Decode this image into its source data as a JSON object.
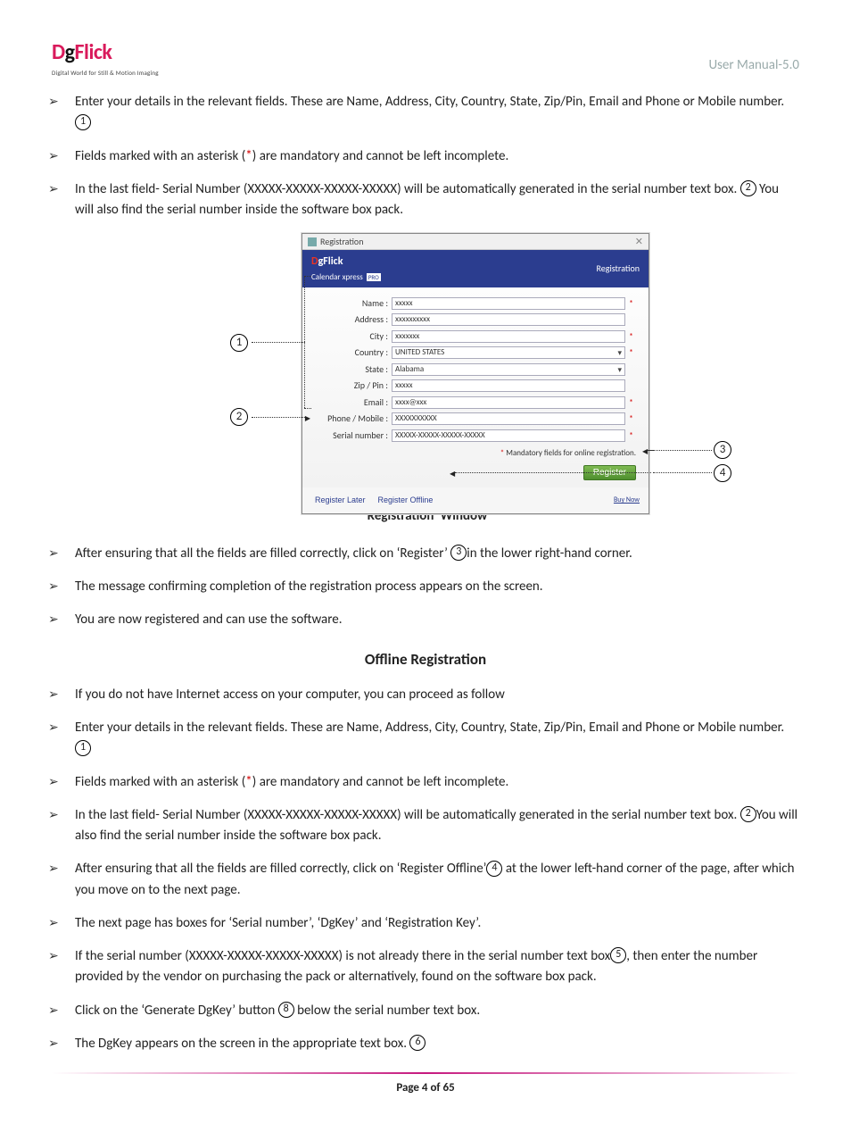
{
  "header": {
    "logo_main": "DgFlick",
    "logo_sub": "Digital World for Still & Motion Imaging",
    "right": "User Manual-5.0"
  },
  "section1": {
    "items": [
      {
        "pre": "Enter your details in the relevant fields. These are Name, Address, City, Country, State, Zip/Pin, Email and Phone or Mobile number. ",
        "circ": "1",
        "post": ""
      },
      {
        "pre": "Fields marked with an asterisk (",
        "red": "*",
        "post2": ") are mandatory and cannot be left incomplete."
      },
      {
        "pre": "In the last field- Serial Number (XXXXX-XXXXX-XXXXX-XXXXX) will be automatically generated in the serial number text box. ",
        "circ": "2",
        "post": " You will also find the serial number inside the software box pack."
      }
    ]
  },
  "figure": {
    "titlebar": "Registration",
    "banner_brand": "DgFlick",
    "banner_sub": "Calendar xpress",
    "banner_pro": "PRO",
    "banner_right": "Registration",
    "rows": [
      {
        "label": "Name :",
        "value": "xxxxx",
        "star": true
      },
      {
        "label": "Address :",
        "value": "xxxxxxxxxx",
        "star": false
      },
      {
        "label": "City :",
        "value": "xxxxxxx",
        "star": true
      },
      {
        "label": "Country :",
        "value": "UNITED STATES",
        "star": true,
        "select": true
      },
      {
        "label": "State :",
        "value": "Alabama",
        "star": false,
        "select": true
      },
      {
        "label": "Zip / Pin :",
        "value": "xxxxx",
        "star": false
      },
      {
        "label": "Email :",
        "value": "xxxx@xxx",
        "star": true
      },
      {
        "label": "Phone / Mobile :",
        "value": "XXXXXXXXXX",
        "star": true
      },
      {
        "label": "Serial number :",
        "value": "XXXXX-XXXXX-XXXXX-XXXXX",
        "star": true
      }
    ],
    "mandatory_note": "Mandatory fields for online registration.",
    "btn_later": "Register Later",
    "btn_offline": "Register Offline",
    "btn_register": "Register",
    "buy_now": "Buy Now",
    "caption": "‘Registration’ Window"
  },
  "section2": {
    "items": [
      {
        "pre": "After ensuring that all the fields are filled correctly, click on ‘Register’ ",
        "circ": "3",
        "post": "in the lower right-hand corner."
      },
      {
        "pre": "The message confirming completion of the registration process appears on the screen."
      },
      {
        "pre": "You are now registered and can use the software."
      }
    ]
  },
  "offline_heading": "Offline Registration",
  "section3": {
    "items": [
      {
        "pre": "If you do not have Internet access on your computer, you can proceed as follow"
      },
      {
        "pre": "Enter your details in the relevant fields. These are Name, Address, City, Country, State, Zip/Pin, Email and Phone or Mobile number. ",
        "circ": "1"
      },
      {
        "pre": "Fields marked with an asterisk (",
        "red": "*",
        "post2": ") are mandatory and cannot be left incomplete."
      },
      {
        "pre": "In the last field- Serial Number (XXXXX-XXXXX-XXXXX-XXXXX) will be automatically generated in the serial number text box. ",
        "circ": "2",
        "post": "You will also find the serial number inside the software box pack."
      },
      {
        "pre": "After ensuring that all the fields are filled correctly, click on ‘Register Offline’",
        "circ": "4",
        "post": " at the lower left-hand corner of the page, after which you move on to the next page."
      },
      {
        "pre": "The next page has boxes for ‘Serial number’, ‘DgKey’ and ‘Registration Key’."
      },
      {
        "pre": "If the serial number (XXXXX-XXXXX-XXXXX-XXXXX) is not already there in the serial number text box",
        "circ": "5",
        "post": ", then enter the number provided by the vendor on purchasing the pack or alternatively, found on the software box pack."
      },
      {
        "pre": "Click on the ‘Generate DgKey’ button ",
        "circ": "8",
        "post": " below the serial number text box."
      },
      {
        "pre": "The DgKey appears on the screen in the appropriate text box. ",
        "circ": "6"
      }
    ]
  },
  "footer": {
    "page": "Page 4 of 65"
  }
}
